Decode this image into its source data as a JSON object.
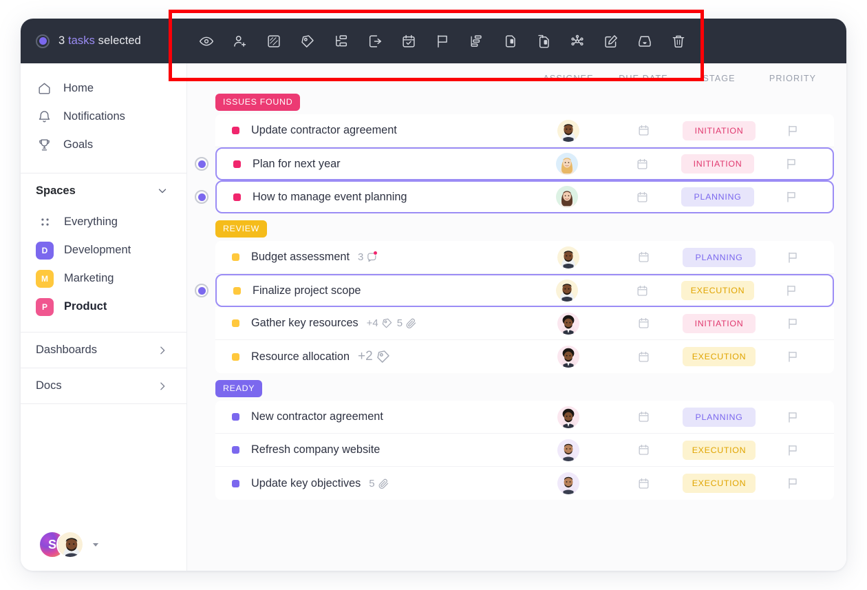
{
  "topbar": {
    "selection_count": "3",
    "selection_keyword": "tasks",
    "selection_suffix": "selected",
    "selection_text_full": "3 tasks selected",
    "actions": [
      {
        "name": "watch-icon",
        "label": "Watch"
      },
      {
        "name": "assign-user-icon",
        "label": "Assign"
      },
      {
        "name": "status-icon",
        "label": "Status"
      },
      {
        "name": "tag-icon",
        "label": "Tags"
      },
      {
        "name": "subtask-icon",
        "label": "Subtasks"
      },
      {
        "name": "move-icon",
        "label": "Move"
      },
      {
        "name": "calendar-check-icon",
        "label": "Due date"
      },
      {
        "name": "flag-icon",
        "label": "Priority"
      },
      {
        "name": "dependency-icon",
        "label": "Dependencies"
      },
      {
        "name": "duplicate-icon",
        "label": "Duplicate"
      },
      {
        "name": "copy-icon",
        "label": "Copy"
      },
      {
        "name": "merge-icon",
        "label": "Merge"
      },
      {
        "name": "edit-icon",
        "label": "Edit"
      },
      {
        "name": "archive-icon",
        "label": "Archive"
      },
      {
        "name": "delete-icon",
        "label": "Delete"
      }
    ]
  },
  "sidebar": {
    "nav": [
      {
        "label": "Home",
        "icon": "home-icon"
      },
      {
        "label": "Notifications",
        "icon": "bell-icon"
      },
      {
        "label": "Goals",
        "icon": "trophy-icon"
      }
    ],
    "spaces_header": "Spaces",
    "spaces": [
      {
        "label": "Everything",
        "icon": "grid-icon",
        "initial": "",
        "color": ""
      },
      {
        "label": "Development",
        "icon": "space-square",
        "initial": "D",
        "color": "#7b68ee"
      },
      {
        "label": "Marketing",
        "icon": "space-square",
        "initial": "M",
        "color": "#ffc83d"
      },
      {
        "label": "Product",
        "icon": "space-square",
        "initial": "P",
        "color": "#f0568f"
      }
    ],
    "links": [
      {
        "label": "Dashboards"
      },
      {
        "label": "Docs"
      }
    ],
    "user": {
      "initial": "S"
    }
  },
  "columns": {
    "assignee": "ASSIGNEE",
    "due_date": "DUE DATE",
    "stage": "STAGE",
    "priority": "PRIORITY"
  },
  "groups": [
    {
      "name": "ISSUES FOUND",
      "color": "#ec3a73",
      "bullet": "#f0266d",
      "tasks": [
        {
          "title": "Update contractor agreement",
          "selected": false,
          "stage": "INITIATION",
          "stage_bg": "#fde7ef",
          "stage_fg": "#e0396f",
          "avatar": "avatar-dark-beard",
          "meta": []
        },
        {
          "title": "Plan for next year",
          "selected": true,
          "stage": "INITIATION",
          "stage_bg": "#fde7ef",
          "stage_fg": "#e0396f",
          "avatar": "avatar-blonde-woman",
          "meta": []
        },
        {
          "title": "How to manage event planning",
          "selected": true,
          "stage": "PLANNING",
          "stage_bg": "#e7e5fb",
          "stage_fg": "#7b68ee",
          "avatar": "avatar-brunette-woman",
          "meta": []
        }
      ]
    },
    {
      "name": "REVIEW",
      "color": "#f5bc1b",
      "bullet": "#ffc83d",
      "tasks": [
        {
          "title": "Budget assessment",
          "selected": false,
          "stage": "PLANNING",
          "stage_bg": "#e7e5fb",
          "stage_fg": "#7b68ee",
          "avatar": "avatar-dark-beard",
          "meta": [
            {
              "value": "3",
              "icon": "comment-icon",
              "unread": true
            }
          ]
        },
        {
          "title": "Finalize project scope",
          "selected": true,
          "stage": "EXECUTION",
          "stage_bg": "#fdf3cf",
          "stage_fg": "#e0a400",
          "avatar": "avatar-dark-beard",
          "meta": []
        },
        {
          "title": "Gather key resources",
          "selected": false,
          "stage": "INITIATION",
          "stage_bg": "#fde7ef",
          "stage_fg": "#e0396f",
          "avatar": "avatar-afro",
          "meta": [
            {
              "value": "+4",
              "icon": "tag-icon"
            },
            {
              "value": "5",
              "icon": "paperclip-icon"
            }
          ]
        },
        {
          "title": "Resource allocation",
          "selected": false,
          "stage": "EXECUTION",
          "stage_bg": "#fdf3cf",
          "stage_fg": "#e0a400",
          "avatar": "avatar-afro",
          "meta": [
            {
              "value": "+2",
              "icon": "tag-icon",
              "large": true
            }
          ]
        }
      ]
    },
    {
      "name": "READY",
      "color": "#7b68ee",
      "bullet": "#7b68ee",
      "tasks": [
        {
          "title": "New contractor agreement",
          "selected": false,
          "stage": "PLANNING",
          "stage_bg": "#e7e5fb",
          "stage_fg": "#7b68ee",
          "avatar": "avatar-afro",
          "meta": []
        },
        {
          "title": "Refresh company website",
          "selected": false,
          "stage": "EXECUTION",
          "stage_bg": "#fdf3cf",
          "stage_fg": "#e0a400",
          "avatar": "avatar-short-beard",
          "meta": []
        },
        {
          "title": "Update key objectives",
          "selected": false,
          "stage": "EXECUTION",
          "stage_bg": "#fdf3cf",
          "stage_fg": "#e0a400",
          "avatar": "avatar-short-beard",
          "meta": [
            {
              "value": "5",
              "icon": "paperclip-icon"
            }
          ]
        }
      ]
    }
  ],
  "annotation": {
    "color": "#fb0007"
  }
}
